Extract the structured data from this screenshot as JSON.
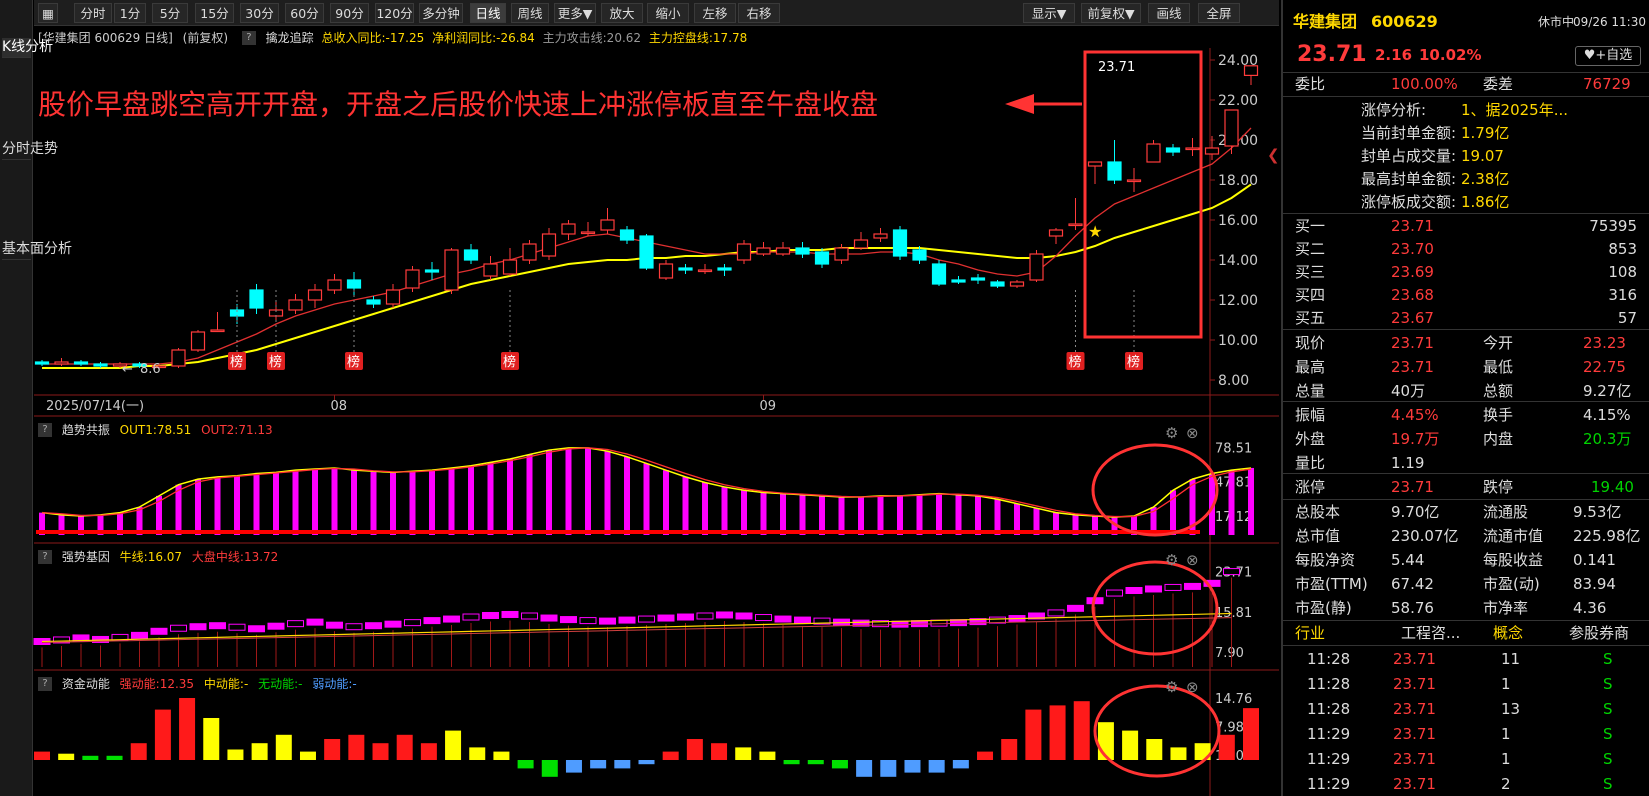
{
  "left_tabs": [
    "K线分析",
    "分时走势",
    "基本面分析"
  ],
  "toolbar": {
    "grid_icon": "grid-icon",
    "buttons": [
      "分时",
      "1分",
      "5分",
      "15分",
      "30分",
      "60分",
      "90分",
      "120分",
      "多分钟",
      "日线",
      "周线",
      "更多▼",
      "放大",
      "缩小",
      "左移",
      "右移",
      "显示▼",
      "前复权▼",
      "画线",
      "全屏"
    ],
    "active": "日线"
  },
  "info": {
    "name": "[华建集团 600629 日线]",
    "fq": "(前复权)",
    "ind_name": "擒龙追踪",
    "p1": "总收入同比:-17.25",
    "p2": "净利润同比:-26.84",
    "p3": "主力攻击线:20.62",
    "p4": "主力控盘线:17.78"
  },
  "colors": {
    "up": "#ff3b3b",
    "down": "#00ffff",
    "ma_yellow": "#ffff00",
    "annot": "#ff3333",
    "bg": "#000000"
  },
  "annotation": {
    "text": "股价早盘跳空高开开盘，开盘之后股价快速上冲涨停板直至午盘收盘",
    "last_price_label": "23.71",
    "low_label": "8.6"
  },
  "markers": {
    "bang": "榜"
  },
  "main_axis": {
    "ticks": [
      "24.00",
      "22.00",
      "20.00",
      "18.00",
      "16.00",
      "14.00",
      "12.00",
      "10.00",
      "8.00"
    ],
    "date_start": "2025/07/14(一)",
    "date_08": "08",
    "date_09": "09"
  },
  "ind1": {
    "title": "趋势共振",
    "out1": "OUT1:78.51",
    "out2": "OUT2:71.13",
    "ticks": [
      "78.51",
      "47.81",
      "17.12"
    ]
  },
  "ind2": {
    "title": "强势基因",
    "niu": "牛线:16.07",
    "dapan": "大盘中线:13.72",
    "ticks": [
      "23.71",
      "15.81",
      "7.90"
    ]
  },
  "ind3": {
    "title": "资金动能",
    "strong": "强动能:12.35",
    "mid": "中动能:-",
    "none": "无动能:-",
    "weak": "弱动能:-",
    "ticks": [
      "14.76",
      "7.98",
      "1.20"
    ]
  },
  "chart_data": {
    "type": "candlestick",
    "title": "华建集团 600629 日线 (前复权)",
    "ylim": [
      8,
      24
    ],
    "candles": [
      [
        8.9,
        8.8,
        9.0,
        8.7
      ],
      [
        8.8,
        8.9,
        9.1,
        8.7
      ],
      [
        8.9,
        8.8,
        9.0,
        8.7
      ],
      [
        8.8,
        8.7,
        8.9,
        8.6
      ],
      [
        8.7,
        8.8,
        8.9,
        8.6
      ],
      [
        8.8,
        8.7,
        8.9,
        8.6
      ],
      [
        8.7,
        8.7,
        8.8,
        8.6
      ],
      [
        8.7,
        9.5,
        9.6,
        8.6
      ],
      [
        9.5,
        10.4,
        10.5,
        9.4
      ],
      [
        10.5,
        10.5,
        11.4,
        10.4
      ],
      [
        11.5,
        11.2,
        11.8,
        10.8
      ],
      [
        12.5,
        11.6,
        12.8,
        11.3
      ],
      [
        11.2,
        11.5,
        11.9,
        10.9
      ],
      [
        11.5,
        12.0,
        12.3,
        11.3
      ],
      [
        12.0,
        12.5,
        12.8,
        11.6
      ],
      [
        12.5,
        13.0,
        13.3,
        12.3
      ],
      [
        13.0,
        12.6,
        13.4,
        12.2
      ],
      [
        12.0,
        11.8,
        12.2,
        11.6
      ],
      [
        11.8,
        12.5,
        12.8,
        11.6
      ],
      [
        12.6,
        13.5,
        13.7,
        12.4
      ],
      [
        13.5,
        13.4,
        13.9,
        13.0
      ],
      [
        12.5,
        14.5,
        14.6,
        12.3
      ],
      [
        14.5,
        14.0,
        14.8,
        13.8
      ],
      [
        13.2,
        13.8,
        14.2,
        13.0
      ],
      [
        13.3,
        14.0,
        14.6,
        13.2
      ],
      [
        14.0,
        14.8,
        15.0,
        13.8
      ],
      [
        14.2,
        15.3,
        15.6,
        14.0
      ],
      [
        15.3,
        15.8,
        16.0,
        15.0
      ],
      [
        15.4,
        15.4,
        15.9,
        15.2
      ],
      [
        15.5,
        16.0,
        16.6,
        15.3
      ],
      [
        15.5,
        15.0,
        15.7,
        14.8
      ],
      [
        15.2,
        13.6,
        15.3,
        13.5
      ],
      [
        13.1,
        13.8,
        14.0,
        13.0
      ],
      [
        13.6,
        13.5,
        13.8,
        13.3
      ],
      [
        13.5,
        13.5,
        13.8,
        13.3
      ],
      [
        13.6,
        13.5,
        13.8,
        13.2
      ],
      [
        14.0,
        14.8,
        15.0,
        13.8
      ],
      [
        14.3,
        14.6,
        14.9,
        14.2
      ],
      [
        14.3,
        14.6,
        14.9,
        14.2
      ],
      [
        14.6,
        14.3,
        14.9,
        14.1
      ],
      [
        14.4,
        13.8,
        14.6,
        13.6
      ],
      [
        14.0,
        14.6,
        14.8,
        13.8
      ],
      [
        14.6,
        15.0,
        15.4,
        14.5
      ],
      [
        15.1,
        15.3,
        15.6,
        14.9
      ],
      [
        15.5,
        14.2,
        15.7,
        14.0
      ],
      [
        14.5,
        14.0,
        14.7,
        13.8
      ],
      [
        13.8,
        12.8,
        14.0,
        12.7
      ],
      [
        13.0,
        12.9,
        13.2,
        12.8
      ],
      [
        13.1,
        13.0,
        13.3,
        12.8
      ],
      [
        12.9,
        12.7,
        13.0,
        12.6
      ],
      [
        12.7,
        12.9,
        13.0,
        12.6
      ],
      [
        13.0,
        14.3,
        14.5,
        12.9
      ],
      [
        15.2,
        15.5,
        15.6,
        14.8
      ],
      [
        15.8,
        15.8,
        17.1,
        15.5
      ],
      [
        18.7,
        18.9,
        18.9,
        17.8
      ],
      [
        18.9,
        18.0,
        20.0,
        17.8
      ],
      [
        18.0,
        18.0,
        18.6,
        17.4
      ],
      [
        18.9,
        19.8,
        20.0,
        18.9
      ],
      [
        19.6,
        19.4,
        19.8,
        19.2
      ],
      [
        19.6,
        19.6,
        20.1,
        19.2
      ],
      [
        19.3,
        19.6,
        20.2,
        19.0
      ],
      [
        19.7,
        21.5,
        21.5,
        19.3
      ],
      [
        23.23,
        23.71,
        23.71,
        22.75
      ]
    ],
    "ma_short": [
      8.8,
      8.8,
      8.8,
      8.8,
      8.8,
      8.8,
      8.8,
      8.9,
      9.1,
      9.5,
      9.9,
      10.3,
      10.8,
      11.2,
      11.5,
      11.8,
      12.0,
      12.2,
      12.4,
      12.7,
      13.0,
      13.3,
      13.5,
      13.8,
      14.0,
      14.3,
      14.6,
      14.9,
      15.2,
      15.3,
      15.1,
      14.9,
      14.7,
      14.5,
      14.3,
      14.3,
      14.3,
      14.4,
      14.4,
      14.4,
      14.3,
      14.3,
      14.3,
      14.4,
      14.4,
      14.3,
      14.0,
      13.8,
      13.5,
      13.3,
      13.2,
      13.4,
      14.2,
      15.2,
      16.1,
      16.8,
      17.2,
      17.6,
      18.0,
      18.4,
      18.8,
      19.6,
      20.6
    ],
    "ma_long": [
      8.6,
      8.6,
      8.6,
      8.6,
      8.6,
      8.7,
      8.7,
      8.8,
      8.9,
      9.1,
      9.3,
      9.5,
      9.8,
      10.1,
      10.4,
      10.7,
      11.0,
      11.3,
      11.6,
      11.9,
      12.2,
      12.5,
      12.8,
      13.0,
      13.2,
      13.4,
      13.6,
      13.8,
      13.9,
      14.0,
      14.0,
      14.1,
      14.1,
      14.2,
      14.2,
      14.3,
      14.4,
      14.4,
      14.5,
      14.5,
      14.5,
      14.6,
      14.6,
      14.6,
      14.6,
      14.6,
      14.5,
      14.4,
      14.3,
      14.2,
      14.1,
      14.1,
      14.2,
      14.4,
      14.7,
      15.1,
      15.4,
      15.7,
      16.0,
      16.3,
      16.6,
      17.1,
      17.78
    ],
    "bang_index": [
      10,
      12,
      16,
      24,
      53,
      56
    ],
    "star_index": [
      54
    ],
    "ind1_values": [
      20,
      18,
      17,
      18,
      20,
      25,
      35,
      45,
      50,
      52,
      53,
      55,
      56,
      58,
      59,
      60,
      58,
      57,
      56,
      57,
      58,
      60,
      62,
      65,
      68,
      72,
      76,
      78,
      78,
      75,
      70,
      64,
      58,
      52,
      47,
      43,
      40,
      38,
      37,
      36,
      35,
      34,
      34,
      35,
      35,
      36,
      37,
      36,
      35,
      32,
      28,
      24,
      20,
      18,
      17,
      16,
      17,
      25,
      40,
      50,
      55,
      58,
      60,
      60,
      62,
      65,
      70,
      78.51
    ],
    "ind2_values": [
      10.0,
      10.3,
      10.7,
      10.4,
      10.8,
      11.2,
      12.0,
      12.6,
      12.9,
      13.1,
      12.8,
      12.5,
      13.0,
      13.5,
      13.8,
      13.2,
      12.9,
      13.1,
      13.4,
      13.7,
      14.1,
      14.4,
      14.8,
      15.1,
      15.3,
      15.0,
      14.6,
      14.3,
      14.1,
      14.0,
      14.2,
      14.4,
      14.6,
      14.8,
      15.0,
      15.2,
      15.0,
      14.7,
      14.4,
      14.2,
      14.0,
      13.8,
      13.6,
      13.5,
      13.4,
      13.5,
      13.6,
      13.7,
      13.9,
      14.2,
      14.5,
      15.0,
      15.6,
      16.5,
      18.0,
      19.5,
      20.0,
      20.3,
      20.6,
      20.8,
      21.4,
      23.71
    ],
    "ind3_values": [
      2,
      1.5,
      1,
      1,
      4,
      12,
      14.76,
      10,
      2.5,
      4,
      6,
      2,
      5,
      6,
      4,
      6,
      4,
      7,
      3,
      2,
      -2,
      -4,
      -3,
      -2,
      -2,
      -1,
      2,
      5,
      4,
      3,
      2,
      -1,
      -1,
      -2,
      -4,
      -4,
      -3,
      -3,
      -2,
      2,
      5,
      12,
      13,
      14,
      9,
      7,
      5,
      3,
      4,
      6,
      12.35
    ],
    "ind3_colors": [
      "r",
      "y",
      "g",
      "g",
      "r",
      "r",
      "r",
      "y",
      "y",
      "y",
      "y",
      "y",
      "r",
      "r",
      "r",
      "r",
      "r",
      "y",
      "y",
      "y",
      "g",
      "g",
      "b",
      "b",
      "b",
      "b",
      "r",
      "r",
      "r",
      "y",
      "y",
      "g",
      "g",
      "g",
      "b",
      "b",
      "b",
      "b",
      "b",
      "r",
      "r",
      "r",
      "r",
      "r",
      "y",
      "y",
      "y",
      "y",
      "y",
      "r",
      "r"
    ]
  },
  "right": {
    "name": "华建集团",
    "code": "600629",
    "status": "休市中",
    "datetime": "09/26 11:30",
    "price": "23.71",
    "change": "2.16",
    "pct": "10.02%",
    "add_btn": "+自选",
    "weibi_label": "委比",
    "weibi": "100.00%",
    "weicha_label": "委差",
    "weicha": "76729",
    "limit_lines": [
      {
        "k": "涨停分析:",
        "v": "1、据2025年..."
      },
      {
        "k": "当前封单金额:",
        "v": "1.79亿"
      },
      {
        "k": "封单占成交量:",
        "v": "19.07"
      },
      {
        "k": "最高封单金额:",
        "v": "2.38亿"
      },
      {
        "k": "涨停板成交额:",
        "v": "1.86亿"
      }
    ],
    "book": [
      {
        "l": "买一",
        "p": "23.71",
        "v": "75395"
      },
      {
        "l": "买二",
        "p": "23.70",
        "v": "853"
      },
      {
        "l": "买三",
        "p": "23.69",
        "v": "108"
      },
      {
        "l": "买四",
        "p": "23.68",
        "v": "316"
      },
      {
        "l": "买五",
        "p": "23.67",
        "v": "57"
      }
    ],
    "stats": [
      [
        [
          "现价",
          "23.71",
          "red"
        ],
        [
          "今开",
          "23.23",
          "red"
        ]
      ],
      [
        [
          "最高",
          "23.71",
          "red"
        ],
        [
          "最低",
          "22.75",
          "red"
        ]
      ],
      [
        [
          "总量",
          "40万",
          "white"
        ],
        [
          "总额",
          "9.27亿",
          "white"
        ]
      ]
    ],
    "stats2": [
      [
        [
          "振幅",
          "4.45%",
          "red"
        ],
        [
          "换手",
          "4.15%",
          "white"
        ]
      ],
      [
        [
          "外盘",
          "19.7万",
          "red"
        ],
        [
          "内盘",
          "20.3万",
          "green"
        ]
      ],
      [
        [
          "量比",
          "1.19",
          "white"
        ],
        [
          "",
          "",
          " "
        ]
      ]
    ],
    "limit_row": [
      [
        "涨停",
        "23.71",
        "red"
      ],
      [
        "跌停",
        "19.40",
        "green"
      ]
    ],
    "fund": [
      [
        [
          "总股本",
          "9.70亿"
        ],
        [
          "流通股",
          "9.53亿"
        ]
      ],
      [
        [
          "总市值",
          "230.07亿"
        ],
        [
          "流通市值",
          "225.98亿"
        ]
      ],
      [
        [
          "每股净资",
          "5.44"
        ],
        [
          "每股收益",
          "0.141"
        ]
      ],
      [
        [
          "市盈(TTM)",
          "67.42"
        ],
        [
          "市盈(动)",
          "83.94"
        ]
      ],
      [
        [
          "市盈(静)",
          "58.76"
        ],
        [
          "市净率",
          "4.36"
        ]
      ]
    ],
    "industry": {
      "a": "行业",
      "b": "工程咨...",
      "c": "概念",
      "d": "参股券商"
    },
    "ticks": [
      {
        "t": "11:28",
        "p": "23.71",
        "v": "11",
        "s": "S"
      },
      {
        "t": "11:28",
        "p": "23.71",
        "v": "1",
        "s": "S"
      },
      {
        "t": "11:28",
        "p": "23.71",
        "v": "13",
        "s": "S"
      },
      {
        "t": "11:29",
        "p": "23.71",
        "v": "1",
        "s": "S"
      },
      {
        "t": "11:29",
        "p": "23.71",
        "v": "1",
        "s": "S"
      },
      {
        "t": "11:29",
        "p": "23.71",
        "v": "2",
        "s": "S"
      }
    ]
  }
}
